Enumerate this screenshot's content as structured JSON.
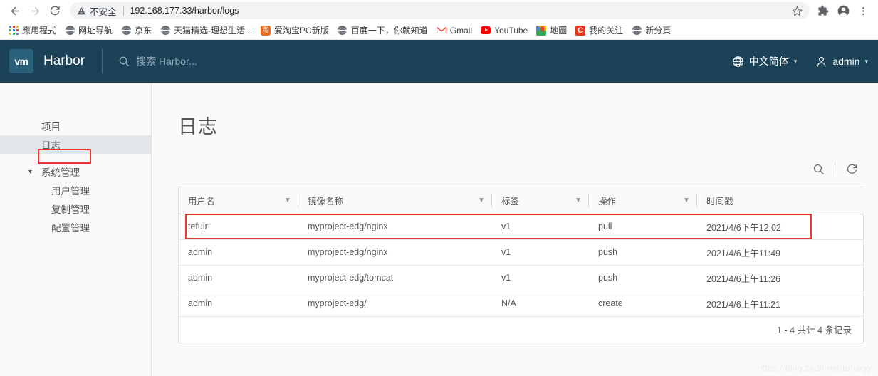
{
  "browser": {
    "back_icon": "back-arrow-icon",
    "forward_icon": "forward-arrow-icon",
    "reload_icon": "reload-icon",
    "omnibox": {
      "warning_label": "不安全",
      "url": "192.168.177.33/harbor/logs",
      "star_icon": "star-icon"
    },
    "extensions_icon": "puzzle-icon",
    "profile_icon": "profile-avatar-icon",
    "menu_icon": "three-dot-menu-icon",
    "bookmarks": [
      {
        "label": "應用程式",
        "icon": "apps-grid-icon"
      },
      {
        "label": "网址导航",
        "icon": "globe-icon"
      },
      {
        "label": "京东",
        "icon": "globe-icon"
      },
      {
        "label": "天猫精选-理想生活...",
        "icon": "globe-icon"
      },
      {
        "label": "爱淘宝PC新版",
        "icon": "taobao-icon"
      },
      {
        "label": "百度一下，你就知道",
        "icon": "globe-icon"
      },
      {
        "label": "Gmail",
        "icon": "gmail-icon"
      },
      {
        "label": "YouTube",
        "icon": "youtube-icon"
      },
      {
        "label": "地圖",
        "icon": "google-maps-icon"
      },
      {
        "label": "我的关注",
        "icon": "csdn-icon"
      },
      {
        "label": "新分頁",
        "icon": "globe-icon"
      }
    ]
  },
  "harbor": {
    "logo_text": "vm",
    "brand": "Harbor",
    "search_placeholder": "搜索 Harbor...",
    "language": "中文简体",
    "user": "admin",
    "sidebar": {
      "items": [
        {
          "label": "项目",
          "selected": false,
          "type": "item"
        },
        {
          "label": "日志",
          "selected": true,
          "type": "item"
        },
        {
          "label": "系统管理",
          "selected": false,
          "type": "group"
        },
        {
          "label": "用户管理",
          "selected": false,
          "type": "child"
        },
        {
          "label": "复制管理",
          "selected": false,
          "type": "child"
        },
        {
          "label": "配置管理",
          "selected": false,
          "type": "child"
        }
      ]
    },
    "page_title": "日志",
    "actions": {
      "search_icon": "search-icon",
      "refresh_icon": "refresh-icon"
    },
    "table": {
      "columns": [
        {
          "label": "用户名",
          "filter": true
        },
        {
          "label": "镜像名称",
          "filter": true
        },
        {
          "label": "标签",
          "filter": true
        },
        {
          "label": "操作",
          "filter": true
        },
        {
          "label": "时间戳",
          "filter": false
        }
      ],
      "rows": [
        {
          "user": "tefuir",
          "repository": "myproject-edg/nginx",
          "tag": "v1",
          "operation": "pull",
          "timestamp": "2021/4/6下午12:02",
          "highlighted": true
        },
        {
          "user": "admin",
          "repository": "myproject-edg/nginx",
          "tag": "v1",
          "operation": "push",
          "timestamp": "2021/4/6上午11:49",
          "highlighted": false
        },
        {
          "user": "admin",
          "repository": "myproject-edg/tomcat",
          "tag": "v1",
          "operation": "push",
          "timestamp": "2021/4/6上午11:26",
          "highlighted": false
        },
        {
          "user": "admin",
          "repository": "myproject-edg/",
          "tag": "N/A",
          "operation": "create",
          "timestamp": "2021/4/6上午11:21",
          "highlighted": false
        }
      ],
      "footer": "1 - 4 共计 4 条记录"
    },
    "watermark": "https://blog.csdn.net/tefuiryy",
    "colors": {
      "header_bg": "#1b4257",
      "logo_bg": "#2a5f7a",
      "annotation": "#e8362a",
      "selected_nav": "#e5e8eb"
    }
  }
}
